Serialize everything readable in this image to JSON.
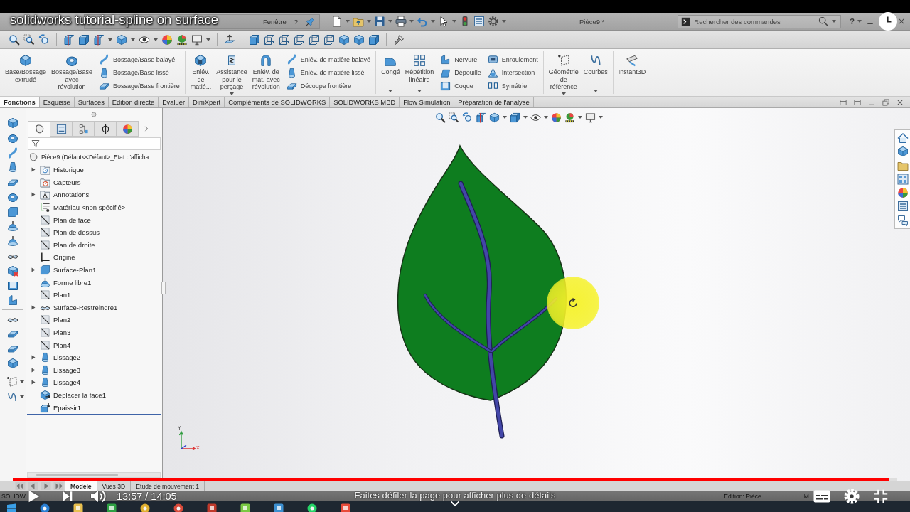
{
  "player": {
    "title": "solidworks tutorial-spline on surface",
    "paused": true,
    "progress": {
      "level": 0.99
    },
    "time": "13:57 / 14:05",
    "hint": "Faites défiler la page pour afficher plus de détails"
  },
  "menu": {
    "items": [
      "Fenêtre",
      "?"
    ],
    "document_title": "Pièce9 *",
    "search": {
      "placeholder": "Rechercher des commandes"
    },
    "help": "?"
  },
  "ribbon": {
    "groups": [
      {
        "items": [
          {
            "kind": "large",
            "label": "Base/Bossage\nextrudé",
            "dropdown": false
          },
          {
            "kind": "large",
            "label": "Bossage/Base\navec\nrévolution",
            "dropdown": false
          },
          {
            "kind": "stack",
            "items": [
              "Bossage/Base balayé",
              "Bossage/Base lissé",
              "Bossage/Base frontière"
            ]
          }
        ]
      },
      {
        "items": [
          {
            "kind": "large",
            "label": "Enlév.\nde\nmatié...",
            "dropdown": false
          },
          {
            "kind": "large",
            "label": "Assistance\npour le\nperçage",
            "dropdown": true
          },
          {
            "kind": "large",
            "label": "Enlév. de\nmat. avec\nrévolution",
            "dropdown": false
          },
          {
            "kind": "stack",
            "items": [
              "Enlév. de matière balayé",
              "Enlév. de matière lissé",
              "Découpe frontière"
            ]
          }
        ]
      },
      {
        "items": [
          {
            "kind": "large",
            "label": "Congé",
            "dropdown": true
          },
          {
            "kind": "large",
            "label": "Répétition\nlinéaire",
            "dropdown": true
          },
          {
            "kind": "stack",
            "items": [
              "Nervure",
              "Dépouille",
              "Coque"
            ]
          },
          {
            "kind": "stack",
            "items": [
              "Enroulement",
              "Intersection",
              "Symétrie"
            ]
          }
        ]
      },
      {
        "items": [
          {
            "kind": "large",
            "label": "Géométrie\nde\nréférence",
            "dropdown": true
          },
          {
            "kind": "large",
            "label": "Courbes",
            "dropdown": true
          }
        ]
      },
      {
        "items": [
          {
            "kind": "large",
            "label": "Instant3D",
            "dropdown": false
          }
        ]
      }
    ]
  },
  "tabs": [
    {
      "label": "Fonctions",
      "selected": true
    },
    {
      "label": "Esquisse",
      "selected": false
    },
    {
      "label": "Surfaces",
      "selected": false
    },
    {
      "label": "Edition directe",
      "selected": false
    },
    {
      "label": "Evaluer",
      "selected": false
    },
    {
      "label": "DimXpert",
      "selected": false
    },
    {
      "label": "Compléments de SOLIDWORKS",
      "selected": false
    },
    {
      "label": "SOLIDWORKS MBD",
      "selected": false
    },
    {
      "label": "Flow Simulation",
      "selected": false
    },
    {
      "label": "Préparation de l'analyse",
      "selected": false
    }
  ],
  "feature_manager": {
    "panel_tabs": [
      {
        "selected": true
      },
      {
        "selected": false
      },
      {
        "selected": false
      },
      {
        "selected": false
      },
      {
        "selected": false
      }
    ],
    "root": "Pièce9 (Défaut<<Défaut>_Etat d'afficha",
    "items": [
      {
        "label": "Historique",
        "kind": "history",
        "expandable": true
      },
      {
        "label": "Capteurs",
        "kind": "sensors",
        "expandable": false
      },
      {
        "label": "Annotations",
        "kind": "annotations",
        "expandable": true
      },
      {
        "label": "Matériau <non spécifié>",
        "kind": "material",
        "expandable": false
      },
      {
        "label": "Plan de face",
        "kind": "plane",
        "expandable": false
      },
      {
        "label": "Plan de dessus",
        "kind": "plane",
        "expandable": false
      },
      {
        "label": "Plan de droite",
        "kind": "plane",
        "expandable": false
      },
      {
        "label": "Origine",
        "kind": "origin",
        "expandable": false
      },
      {
        "label": "Surface-Plan1",
        "kind": "surface",
        "expandable": true
      },
      {
        "label": "Forme libre1",
        "kind": "freeform",
        "expandable": false
      },
      {
        "label": "Plan1",
        "kind": "plane",
        "expandable": false
      },
      {
        "label": "Surface-Restreindre1",
        "kind": "trim",
        "expandable": true
      },
      {
        "label": "Plan2",
        "kind": "plane",
        "expandable": false
      },
      {
        "label": "Plan3",
        "kind": "plane",
        "expandable": false
      },
      {
        "label": "Plan4",
        "kind": "plane",
        "expandable": false
      },
      {
        "label": "Lissage2",
        "kind": "loft",
        "expandable": true
      },
      {
        "label": "Lissage3",
        "kind": "loft",
        "expandable": true
      },
      {
        "label": "Lissage4",
        "kind": "loft",
        "expandable": true
      },
      {
        "label": "Déplacer la face1",
        "kind": "move-face",
        "expandable": false
      },
      {
        "label": "Epaissir1",
        "kind": "thicken",
        "expandable": false
      }
    ]
  },
  "triad": {
    "y_label": "Y",
    "x_label": "X"
  },
  "bottom_tabs": [
    {
      "label": "Modèle",
      "selected": true
    },
    {
      "label": "Vues 3D",
      "selected": false
    },
    {
      "label": "Etude de mouvement 1",
      "selected": false
    }
  ],
  "status_bar": {
    "left": "SOLIDW",
    "mode": "Edition: Pièce",
    "right": "M"
  }
}
